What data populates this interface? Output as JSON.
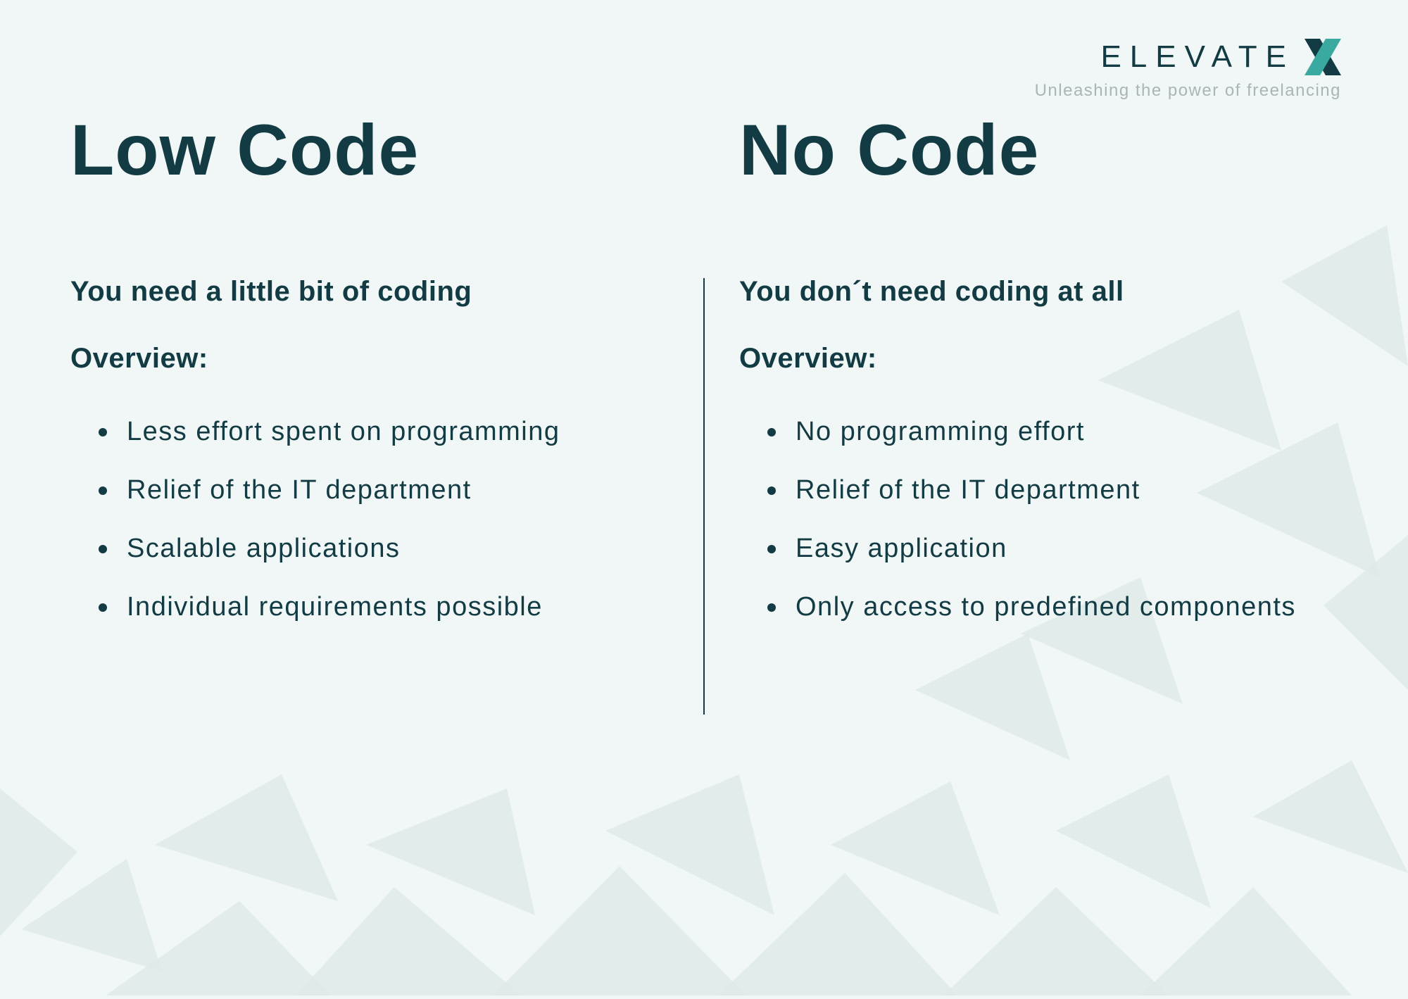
{
  "brand": {
    "name": "ELEVATE",
    "tagline": "Unleashing the power of freelancing"
  },
  "left": {
    "title": "Low Code",
    "subtitle": "You need a little bit of coding",
    "overview_label": "Overview:",
    "items": [
      "Less effort spent on programming",
      "Relief of the IT department",
      "Scalable applications",
      "Individual requirements possible"
    ]
  },
  "right": {
    "title": "No Code",
    "subtitle": "You don´t need coding at all",
    "overview_label": "Overview:",
    "items": [
      "No programming effort",
      "Relief of the IT department",
      "Easy application",
      "Only access to predefined components"
    ]
  }
}
